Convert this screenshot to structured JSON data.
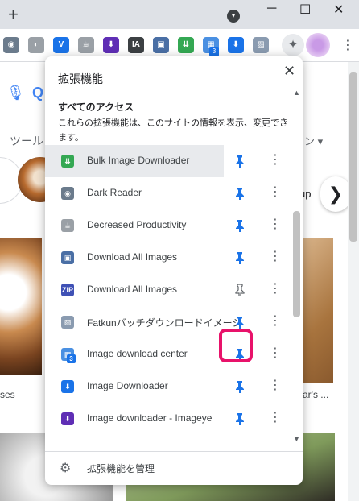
{
  "browser": {
    "new_tab_glyph": "+",
    "tab_search_glyph": "▾",
    "window": {
      "minimize": "─",
      "maximize": "☐",
      "close": "✕"
    },
    "toolbar_icons": [
      {
        "name": "dark-reader-icon",
        "glyph": "◉",
        "color": "#6b7b8c"
      },
      {
        "name": "decreased-productivity-icon",
        "glyph": "◐",
        "color": "#9aa0a6"
      },
      {
        "name": "vpn-icon",
        "glyph": "V",
        "color": "#1a73e8"
      },
      {
        "name": "coffee-icon",
        "glyph": "☕",
        "color": "#9aa0a6"
      },
      {
        "name": "download-icon",
        "glyph": "⬇",
        "color": "#5f2eb5"
      },
      {
        "name": "ia-icon",
        "glyph": "IA",
        "color": "#3c4043"
      },
      {
        "name": "image-icon",
        "glyph": "▣",
        "color": "#4a6fa5"
      },
      {
        "name": "bulk-image-downloader-icon",
        "glyph": "⇊",
        "color": "#34a853"
      },
      {
        "name": "image-download-center-icon",
        "glyph": "▦",
        "color": "#4a90e2",
        "badge": "3"
      },
      {
        "name": "image-downloader-icon",
        "glyph": "⬇",
        "color": "#1a73e8"
      },
      {
        "name": "fatkun-icon",
        "glyph": "▨",
        "color": "#8a9bb0"
      }
    ],
    "extensions_glyph": "✦",
    "menu_glyph": "⋮"
  },
  "page": {
    "tools_text": "ツール",
    "right_fragment": "ン ▾",
    "chip_text": "up",
    "next_glyph": "❯",
    "caption_left": "ses",
    "caption_right": "ar's ..."
  },
  "popup": {
    "title": "拡張機能",
    "close_glyph": "✕",
    "section_heading": "すべてのアクセス",
    "section_description": "これらの拡張機能は、このサイトの情報を表示、変更できます。",
    "pin_glyph": "✚",
    "kebab_glyph": "⋮",
    "extensions": [
      {
        "name": "Bulk Image Downloader",
        "pinned": true,
        "highlighted": true,
        "icon": {
          "glyph": "⇊",
          "color": "#34a853"
        }
      },
      {
        "name": "Dark Reader",
        "pinned": true,
        "icon": {
          "glyph": "◉",
          "color": "#6b7b8c"
        }
      },
      {
        "name": "Decreased Productivity",
        "pinned": true,
        "icon": {
          "glyph": "☕",
          "color": "#9aa0a6"
        }
      },
      {
        "name": "Download All Images",
        "pinned": true,
        "icon": {
          "glyph": "▣",
          "color": "#4a6fa5"
        }
      },
      {
        "name": "Download All Images",
        "pinned": false,
        "icon": {
          "glyph": "ZIP",
          "color": "#3f51b5"
        }
      },
      {
        "name": "Fatkunバッチダウンロードイメージ",
        "pinned": true,
        "icon": {
          "glyph": "▨",
          "color": "#8a9bb0"
        }
      },
      {
        "name": "Image download center",
        "pinned": true,
        "icon": {
          "glyph": "▦",
          "color": "#4a90e2",
          "badge": "3"
        }
      },
      {
        "name": "Image Downloader",
        "pinned": true,
        "icon": {
          "glyph": "⬇",
          "color": "#1a73e8"
        }
      },
      {
        "name": "Image downloader - Imageye",
        "pinned": true,
        "icon": {
          "glyph": "⬇",
          "color": "#5f2eb5"
        }
      }
    ],
    "manage": {
      "icon": "gear-icon",
      "glyph": "⚙",
      "label": "拡張機能を管理"
    }
  },
  "colors": {
    "pin_on": "#1a73e8",
    "pin_off": "#5f6368",
    "highlight_box": "#e8126a"
  }
}
